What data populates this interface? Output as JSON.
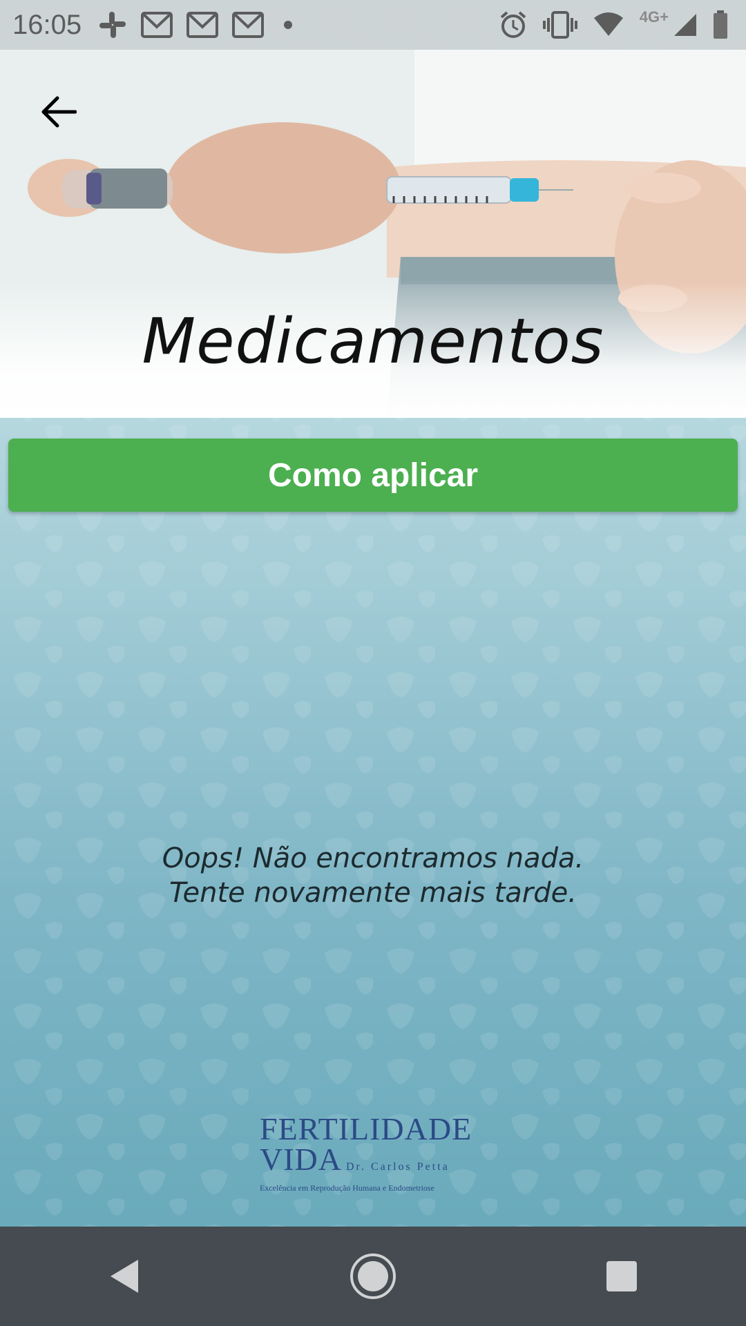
{
  "status_bar": {
    "time": "16:05",
    "network_label": "4G+",
    "left_icons": [
      "slack-icon",
      "gmail-icon",
      "gmail-icon",
      "gmail-icon",
      "notification-dot-icon"
    ],
    "right_icons": [
      "alarm-icon",
      "vibrate-icon",
      "wifi-icon",
      "signal-icon",
      "battery-icon"
    ]
  },
  "header": {
    "back_icon": "arrow-back-icon",
    "title": "Medicamentos"
  },
  "main": {
    "how_to_apply_label": "Como aplicar",
    "empty_line1": "Oops! Não encontramos nada.",
    "empty_line2": "Tente novamente mais tarde."
  },
  "logo": {
    "line1": "FERTILIDADE",
    "line2": "VIDA",
    "doctor": "Dr. Carlos Petta",
    "tagline": "Excelência em Reprodução Humana e Endometriose"
  },
  "nav_bar": {
    "back_icon": "nav-back-icon",
    "home_icon": "nav-home-icon",
    "recents_icon": "nav-recents-icon"
  },
  "colors": {
    "primary_button": "#4caf50",
    "nav_bar": "#454b50",
    "logo": "#2c4a86",
    "background_top": "#b6d8df",
    "background_bottom": "#69aabb"
  }
}
